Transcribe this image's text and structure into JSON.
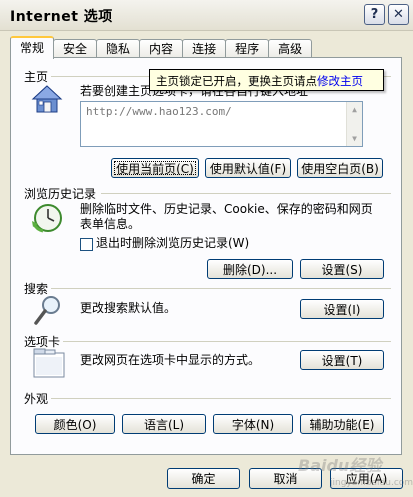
{
  "window": {
    "title": "Internet 选项",
    "help_glyph": "?",
    "close_glyph": "✕"
  },
  "tabs": [
    {
      "label": "常规",
      "active": true
    },
    {
      "label": "安全"
    },
    {
      "label": "隐私"
    },
    {
      "label": "内容"
    },
    {
      "label": "连接"
    },
    {
      "label": "程序"
    },
    {
      "label": "高级"
    }
  ],
  "homepage": {
    "label": "主页",
    "description": "若要创建主页选项卡，请在各自行键入地址",
    "url_value": "http://www.hao123.com/",
    "tooltip_text": "主页锁定已开启，更换主页请点",
    "tooltip_link": "修改主页",
    "buttons": {
      "use_current": "使用当前页(C)",
      "use_default": "使用默认值(F)",
      "use_blank": "使用空白页(B)"
    }
  },
  "history": {
    "label": "浏览历史记录",
    "description_line1": "删除临时文件、历史记录、Cookie、保存的密码和网页",
    "description_line2": "表单信息。",
    "checkbox_label": "退出时删除浏览历史记录(W)",
    "delete_button": "删除(D)...",
    "settings_button": "设置(S)"
  },
  "search": {
    "label": "搜索",
    "description": "更改搜索默认值。",
    "settings_button": "设置(I)"
  },
  "tabs_section": {
    "label": "选项卡",
    "description": "更改网页在选项卡中显示的方式。",
    "settings_button": "设置(T)"
  },
  "appearance": {
    "label": "外观",
    "buttons": {
      "colors": "颜色(O)",
      "languages": "语言(L)",
      "fonts": "字体(N)",
      "accessibility": "辅助功能(E)"
    }
  },
  "footer": {
    "ok": "确定",
    "cancel": "取消",
    "apply": "应用(A)"
  },
  "watermark": {
    "text": "Baidu经验",
    "sub": "jingyan.baidu.com"
  }
}
